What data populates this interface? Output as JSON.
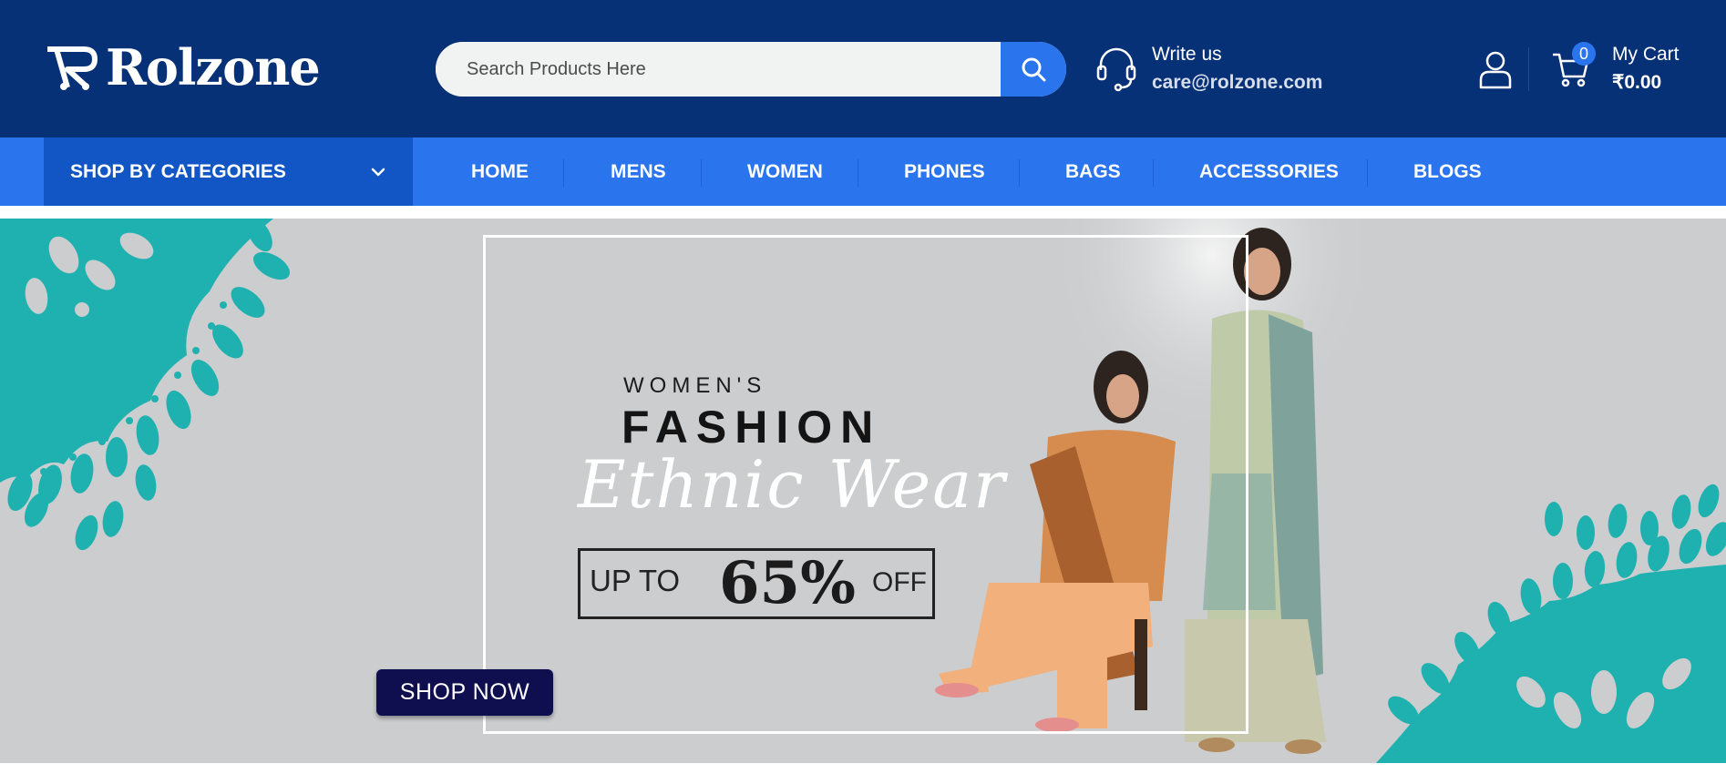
{
  "header": {
    "logo_text": "Rolzone",
    "search": {
      "placeholder": "Search Products Here",
      "icon": "search-icon"
    },
    "contact": {
      "label": "Write us",
      "email": "care@rolzone.com",
      "icon": "headset-icon"
    },
    "account_icon": "user-icon",
    "cart": {
      "count": "0",
      "label": "My Cart",
      "total": "₹0.00",
      "icon": "cart-icon"
    }
  },
  "nav": {
    "categories_label": "SHOP BY CATEGORIES",
    "items": [
      {
        "label": "HOME"
      },
      {
        "label": "MENS"
      },
      {
        "label": "WOMEN"
      },
      {
        "label": "PHONES"
      },
      {
        "label": "BAGS"
      },
      {
        "label": "ACCESSORIES"
      },
      {
        "label": "BLOGS"
      }
    ]
  },
  "banner": {
    "line1": "WOMEN'S",
    "line2": "FASHION",
    "line3": "Ethnic Wear",
    "offer_prefix": "UP TO",
    "offer_value": "65%",
    "offer_suffix": "OFF",
    "cta": "SHOP NOW"
  },
  "colors": {
    "header_bg": "#073177",
    "nav_bg": "#2a74ed",
    "categories_bg": "#1156c4",
    "banner_bg": "#cbcdcf",
    "mandala": "#1fb1b0",
    "cta_bg": "#0f0e4f"
  }
}
